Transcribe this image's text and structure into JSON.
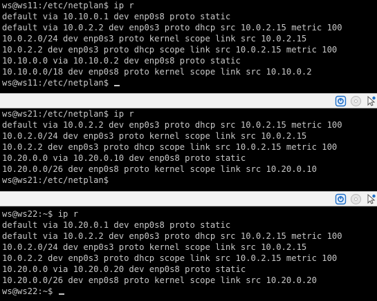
{
  "terminal_ws11": {
    "lines": [
      "ws@ws11:/etc/netplan$ ip r",
      "default via 10.10.0.1 dev enp0s8 proto static",
      "default via 10.0.2.2 dev enp0s3 proto dhcp src 10.0.2.15 metric 100",
      "10.0.2.0/24 dev enp0s3 proto kernel scope link src 10.0.2.15",
      "10.0.2.2 dev enp0s3 proto dhcp scope link src 10.0.2.15 metric 100",
      "10.10.0.0 via 10.10.0.2 dev enp0s8 proto static",
      "10.10.0.0/18 dev enp0s8 proto kernel scope link src 10.10.0.2",
      "ws@ws11:/etc/netplan$ "
    ]
  },
  "terminal_ws21": {
    "lines": [
      "ws@ws21:/etc/netplan$ ip r",
      "default via 10.0.2.2 dev enp0s3 proto dhcp src 10.0.2.15 metric 100",
      "10.0.2.0/24 dev enp0s3 proto kernel scope link src 10.0.2.15",
      "10.0.2.2 dev enp0s3 proto dhcp scope link src 10.0.2.15 metric 100",
      "10.20.0.0 via 10.20.0.10 dev enp0s8 proto static",
      "10.20.0.0/26 dev enp0s8 proto kernel scope link src 10.20.0.10",
      "ws@ws21:/etc/netplan$"
    ]
  },
  "terminal_ws22": {
    "lines": [
      "ws@ws22:~$ ip r",
      "default via 10.20.0.1 dev enp0s8 proto static",
      "default via 10.0.2.2 dev enp0s3 proto dhcp src 10.0.2.15 metric 100",
      "10.0.2.0/24 dev enp0s3 proto kernel scope link src 10.0.2.15",
      "10.0.2.2 dev enp0s3 proto dhcp scope link src 10.0.2.15 metric 100",
      "10.20.0.0 via 10.20.0.20 dev enp0s8 proto static",
      "10.20.0.0/26 dev enp0s8 proto kernel scope link src 10.20.0.20",
      "ws@ws22:~$ "
    ]
  },
  "statusbar": {
    "icons": [
      "network-adapter-icon",
      "optical-drive-icon",
      "mouse-integration-icon"
    ]
  },
  "colors": {
    "terminal_bg": "#000000",
    "terminal_fg": "#c8c8c8",
    "statusbar_bg": "#f2f2f2",
    "accent_blue": "#1f6fc8"
  }
}
